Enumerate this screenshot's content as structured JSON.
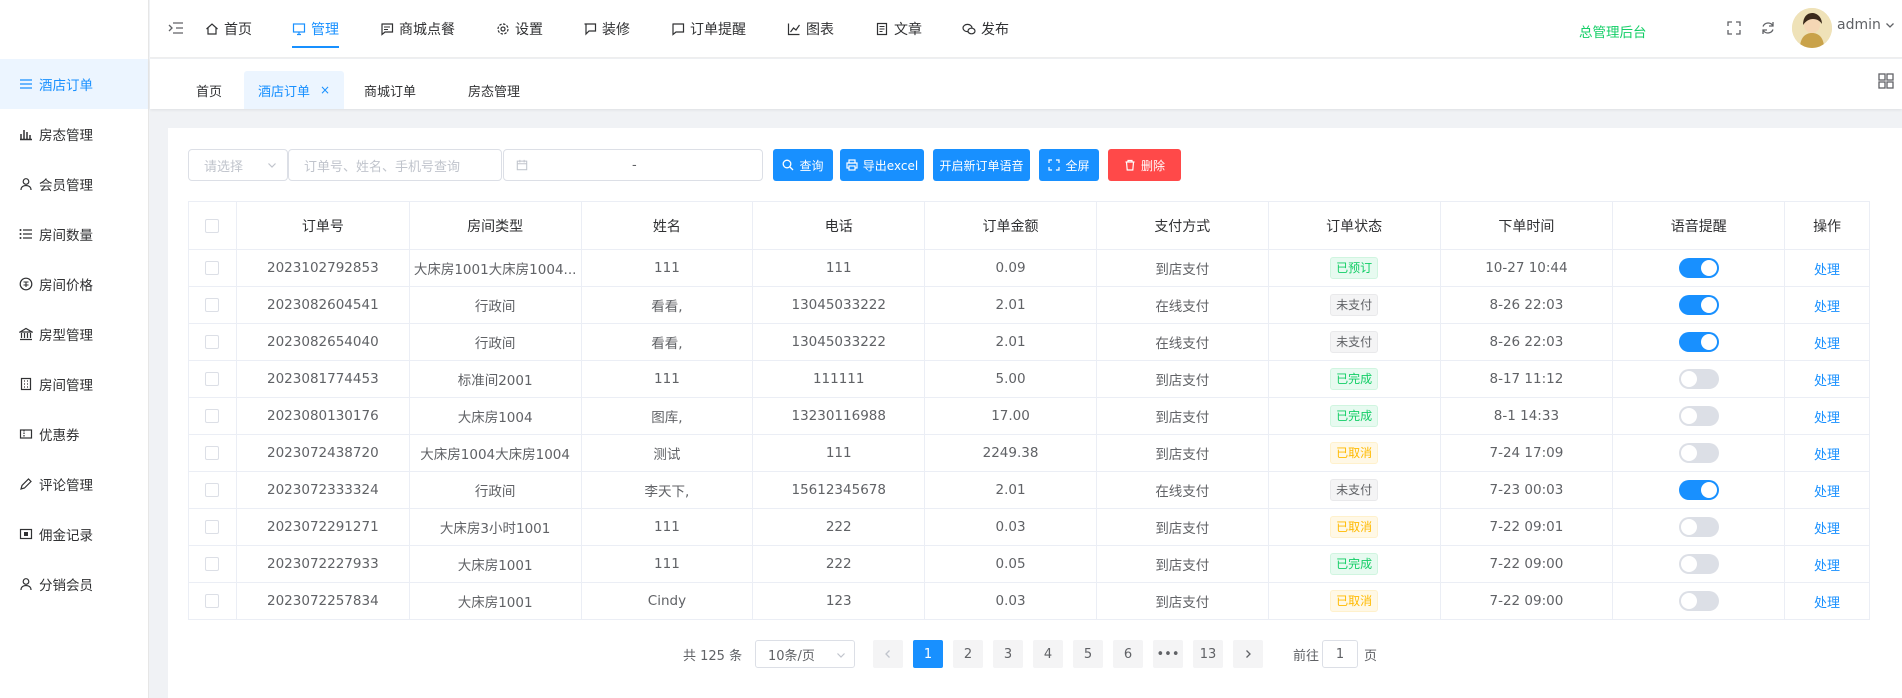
{
  "sidebar": {
    "items": [
      {
        "label": "酒店订单",
        "icon": "list-icon",
        "active": true
      },
      {
        "label": "房态管理",
        "icon": "bar-chart-icon"
      },
      {
        "label": "会员管理",
        "icon": "user-icon"
      },
      {
        "label": "房间数量",
        "icon": "ordered-list-icon"
      },
      {
        "label": "房间价格",
        "icon": "money-icon"
      },
      {
        "label": "房型管理",
        "icon": "bank-icon"
      },
      {
        "label": "房间管理",
        "icon": "building-icon"
      },
      {
        "label": "优惠券",
        "icon": "ticket-icon"
      },
      {
        "label": "评论管理",
        "icon": "edit-icon"
      },
      {
        "label": "佣金记录",
        "icon": "wallet-icon"
      },
      {
        "label": "分销会员",
        "icon": "user-icon"
      }
    ]
  },
  "topnav": {
    "items": [
      {
        "label": "首页",
        "icon": "home-icon"
      },
      {
        "label": "管理",
        "icon": "monitor-icon",
        "active": true
      },
      {
        "label": "商城点餐",
        "icon": "message-icon"
      },
      {
        "label": "设置",
        "icon": "gear-icon"
      },
      {
        "label": "装修",
        "icon": "brush-icon"
      },
      {
        "label": "订单提醒",
        "icon": "message-icon"
      },
      {
        "label": "图表",
        "icon": "line-chart-icon"
      },
      {
        "label": "文章",
        "icon": "document-icon"
      },
      {
        "label": "发布",
        "icon": "wechat-icon"
      }
    ],
    "admin_title": "总管理后台",
    "username": "admin"
  },
  "tabs": [
    {
      "label": "首页"
    },
    {
      "label": "酒店订单",
      "active": true,
      "close": "×"
    },
    {
      "label": "商城订单"
    },
    {
      "label": "房态管理"
    }
  ],
  "toolbar": {
    "select_placeholder": "请选择",
    "search_placeholder": "订单号、姓名、手机号查询",
    "date_separator": "-",
    "query_label": "查询",
    "export_label": "导出excel",
    "voice_label": "开启新订单语音",
    "fullscreen_label": "全屏",
    "delete_label": "删除"
  },
  "table": {
    "headers": [
      "订单号",
      "房间类型",
      "姓名",
      "电话",
      "订单金额",
      "支付方式",
      "订单状态",
      "下单时间",
      "语音提醒",
      "操作"
    ],
    "action_label": "处理",
    "rows": [
      {
        "order_no": "2023102792853",
        "room_type": "大床房1001大床房1004...",
        "name": "111",
        "phone": "111",
        "amount": "0.09",
        "pay": "到店支付",
        "status": "已预订",
        "status_color": "green",
        "time": "10-27 10:44",
        "voice": true
      },
      {
        "order_no": "2023082604541",
        "room_type": "行政间",
        "name": "看看,",
        "phone": "13045033222",
        "amount": "2.01",
        "pay": "在线支付",
        "status": "未支付",
        "status_color": "gray",
        "time": "8-26 22:03",
        "voice": true
      },
      {
        "order_no": "2023082654040",
        "room_type": "行政间",
        "name": "看看,",
        "phone": "13045033222",
        "amount": "2.01",
        "pay": "在线支付",
        "status": "未支付",
        "status_color": "gray",
        "time": "8-26 22:03",
        "voice": true
      },
      {
        "order_no": "2023081774453",
        "room_type": "标准间2001",
        "name": "111",
        "phone": "111111",
        "amount": "5.00",
        "pay": "到店支付",
        "status": "已完成",
        "status_color": "green",
        "time": "8-17 11:12",
        "voice": false
      },
      {
        "order_no": "2023080130176",
        "room_type": "大床房1004",
        "name": "图库,",
        "phone": "13230116988",
        "amount": "17.00",
        "pay": "到店支付",
        "status": "已完成",
        "status_color": "green",
        "time": "8-1 14:33",
        "voice": false
      },
      {
        "order_no": "2023072438720",
        "room_type": "大床房1004大床房1004",
        "name": "测试",
        "phone": "111",
        "amount": "2249.38",
        "pay": "到店支付",
        "status": "已取消",
        "status_color": "orange",
        "time": "7-24 17:09",
        "voice": false
      },
      {
        "order_no": "2023072333324",
        "room_type": "行政间",
        "name": "李天下,",
        "phone": "15612345678",
        "amount": "2.01",
        "pay": "在线支付",
        "status": "未支付",
        "status_color": "gray",
        "time": "7-23 00:03",
        "voice": true
      },
      {
        "order_no": "2023072291271",
        "room_type": "大床房3小时1001",
        "name": "111",
        "phone": "222",
        "amount": "0.03",
        "pay": "到店支付",
        "status": "已取消",
        "status_color": "orange",
        "time": "7-22 09:01",
        "voice": false
      },
      {
        "order_no": "2023072227933",
        "room_type": "大床房1001",
        "name": "111",
        "phone": "222",
        "amount": "0.05",
        "pay": "到店支付",
        "status": "已完成",
        "status_color": "green",
        "time": "7-22 09:00",
        "voice": false
      },
      {
        "order_no": "2023072257834",
        "room_type": "大床房1001",
        "name": "Cindy",
        "phone": "123",
        "amount": "0.03",
        "pay": "到店支付",
        "status": "已取消",
        "status_color": "orange",
        "time": "7-22 09:00",
        "voice": false
      }
    ]
  },
  "pagination": {
    "total_text": "共 125 条",
    "page_size": "10条/页",
    "pages": [
      "1",
      "2",
      "3",
      "4",
      "5",
      "6",
      "•••",
      "13"
    ],
    "current": "1",
    "goto_prefix": "前往",
    "goto_value": "1",
    "goto_suffix": "页"
  },
  "colors": {
    "primary": "#1890ff",
    "danger": "#ff4949",
    "success": "#13ce66",
    "warning": "#ffba00"
  }
}
